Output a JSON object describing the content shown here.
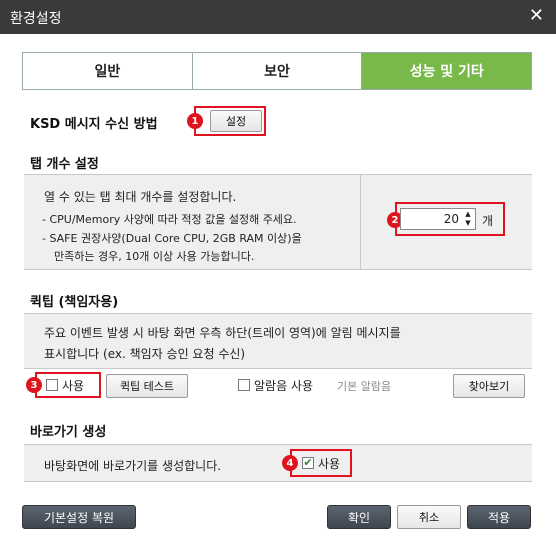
{
  "window": {
    "title": "환경설정",
    "close_glyph": "✕"
  },
  "tabs": [
    {
      "label": "일반",
      "active": false
    },
    {
      "label": "보안",
      "active": false
    },
    {
      "label": "성능 및 기타",
      "active": true
    }
  ],
  "ksd": {
    "heading": "KSD 메시지 수신 방법",
    "setting_button": "설정",
    "badge": "1"
  },
  "tab_count": {
    "heading": "탭 개수 설정",
    "description": "열 수 있는 탭 최대 개수를 설정합니다.",
    "note1": "- CPU/Memory 사양에 따라 적정 값을 설정해 주세요.",
    "note2_line1": "- SAFE 권장사양(Dual Core CPU, 2GB RAM 이상)을",
    "note2_line2": "만족하는 경우, 10개 이상 사용 가능합니다.",
    "value": "20",
    "unit": "개",
    "badge": "2"
  },
  "quicktip": {
    "heading": "퀵팁 (책임자용)",
    "desc_line1": "주요 이벤트 발생 시 바탕 화면 우측 하단(트레이 영역)에 알림 메시지를",
    "desc_line2": "표시합니다 (ex. 책임자 승인 요청 수신)",
    "use_label": "사용",
    "use_checked": false,
    "test_button": "퀵팁 테스트",
    "sound_label": "알람음 사용",
    "sound_checked": false,
    "sound_default": "기본 알람음",
    "browse_button": "찾아보기",
    "badge": "3"
  },
  "shortcut": {
    "heading": "바로가기 생성",
    "description": "바탕화면에 바로가기를 생성합니다.",
    "use_label": "사용",
    "use_checked": true,
    "check_glyph": "✔",
    "badge": "4"
  },
  "footer": {
    "restore_button": "기본설정 복원",
    "ok_button": "확인",
    "cancel_button": "취소",
    "apply_button": "적용"
  },
  "colors": {
    "accent": "#78b94a",
    "highlight": "#e0141e",
    "titlebar": "#3a3a3a"
  }
}
